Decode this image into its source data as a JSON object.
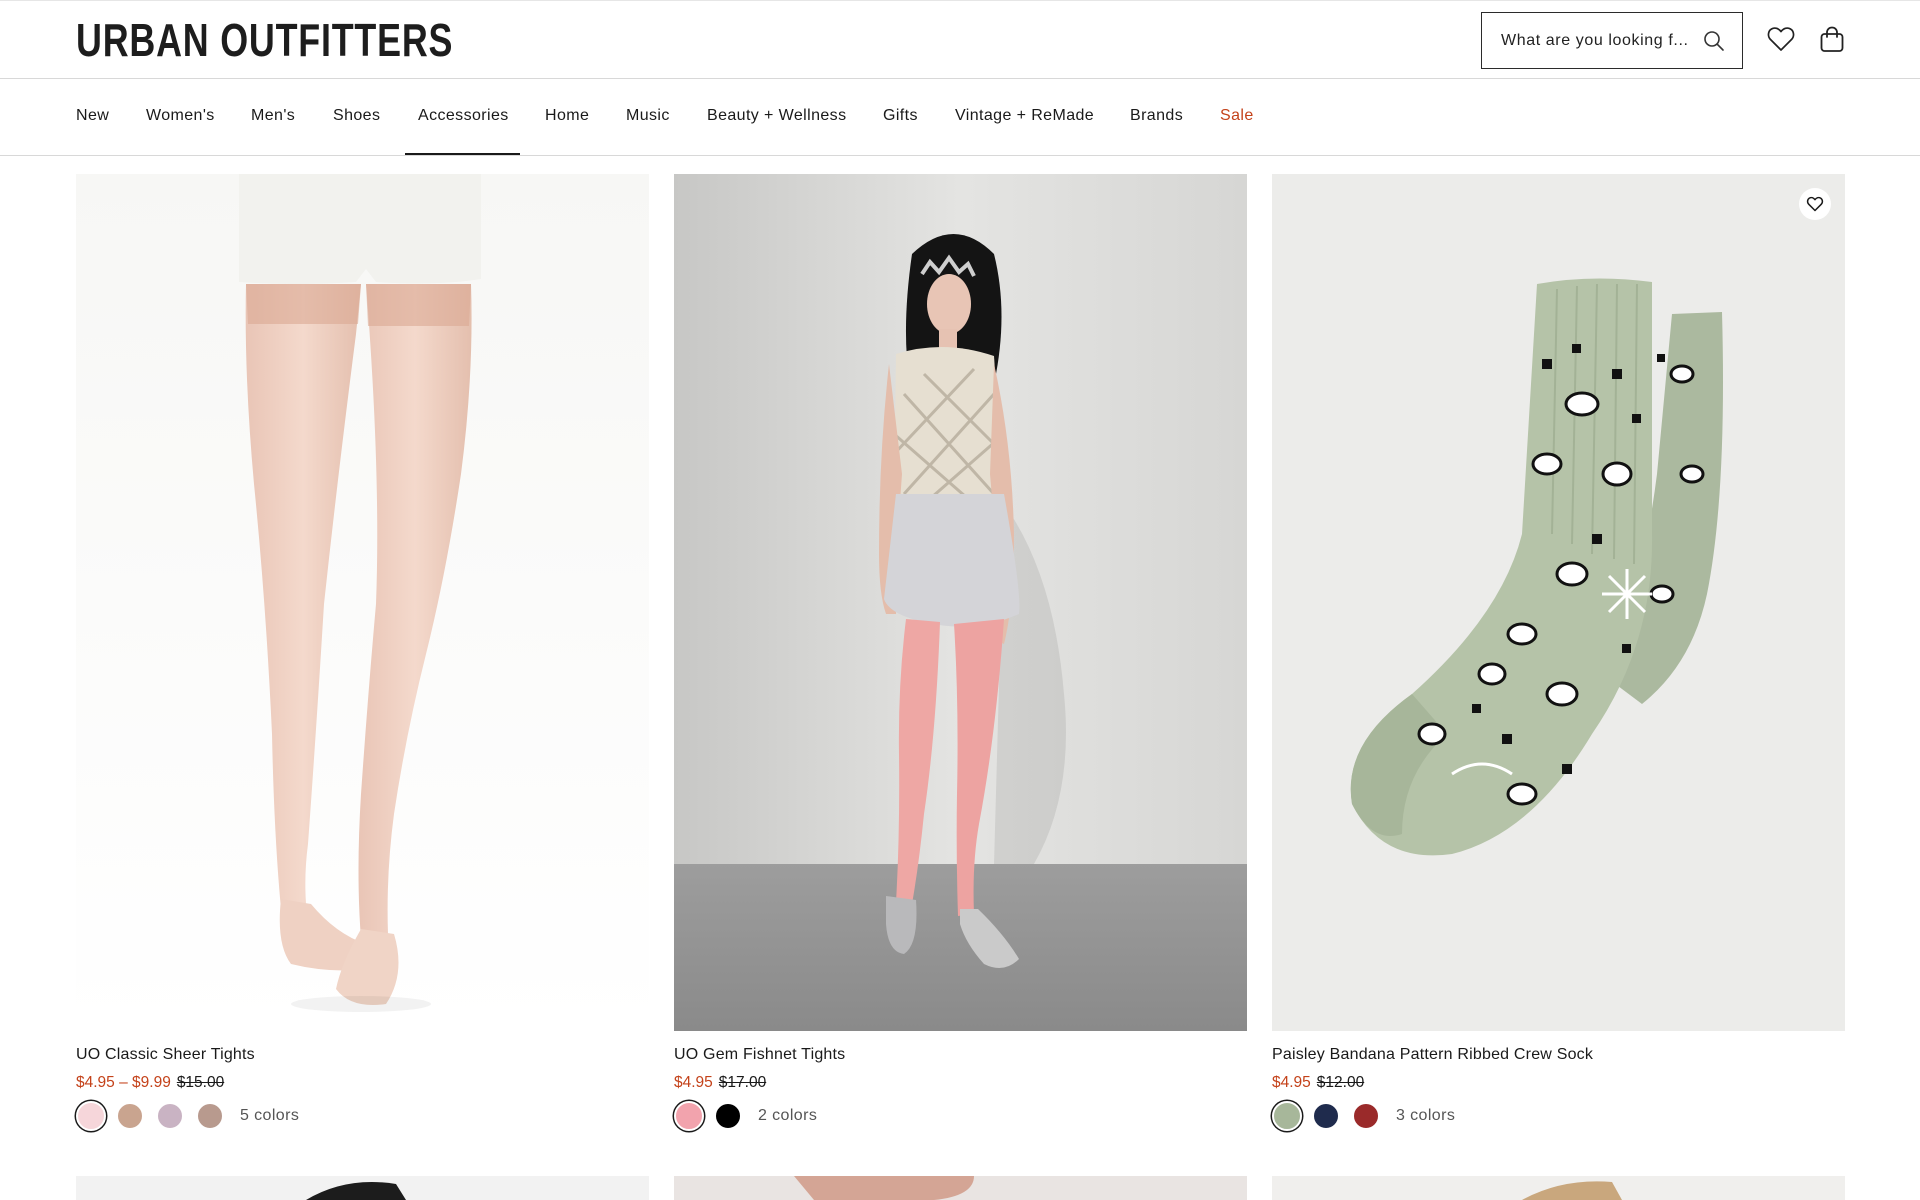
{
  "header": {
    "logo": "URBAN OUTFITTERS",
    "search_placeholder": "What are you looking f...",
    "icons": [
      "search-icon",
      "heart-icon",
      "shopping-bag-icon"
    ]
  },
  "nav": {
    "items": [
      "New",
      "Women's",
      "Men's",
      "Shoes",
      "Accessories",
      "Home",
      "Music",
      "Beauty + Wellness",
      "Gifts",
      "Vintage + ReMade",
      "Brands",
      "Sale"
    ],
    "active": "Accessories",
    "sale_color": "#c4421a"
  },
  "products": [
    {
      "title": "UO Classic Sheer Tights",
      "price": "$4.95 – $9.99",
      "original_price": "$15.00",
      "swatches": [
        "#f6d6da",
        "#c9a48f",
        "#c9b3c3",
        "#b89a8e"
      ],
      "colors_label": "5 colors"
    },
    {
      "title": "UO Gem Fishnet Tights",
      "price": "$4.95",
      "original_price": "$17.00",
      "swatches": [
        "#f2a3ad",
        "#000000"
      ],
      "colors_label": "2 colors"
    },
    {
      "title": "Paisley Bandana Pattern Ribbed Crew Sock",
      "price": "$4.95",
      "original_price": "$12.00",
      "swatches": [
        "#a7b79a",
        "#1f2b4d",
        "#9a2a2a"
      ],
      "colors_label": "3 colors"
    }
  ],
  "colors": {
    "accent_sale": "#c4421a",
    "text": "#1a1a1a",
    "sock_green": "#b4c1a6"
  }
}
